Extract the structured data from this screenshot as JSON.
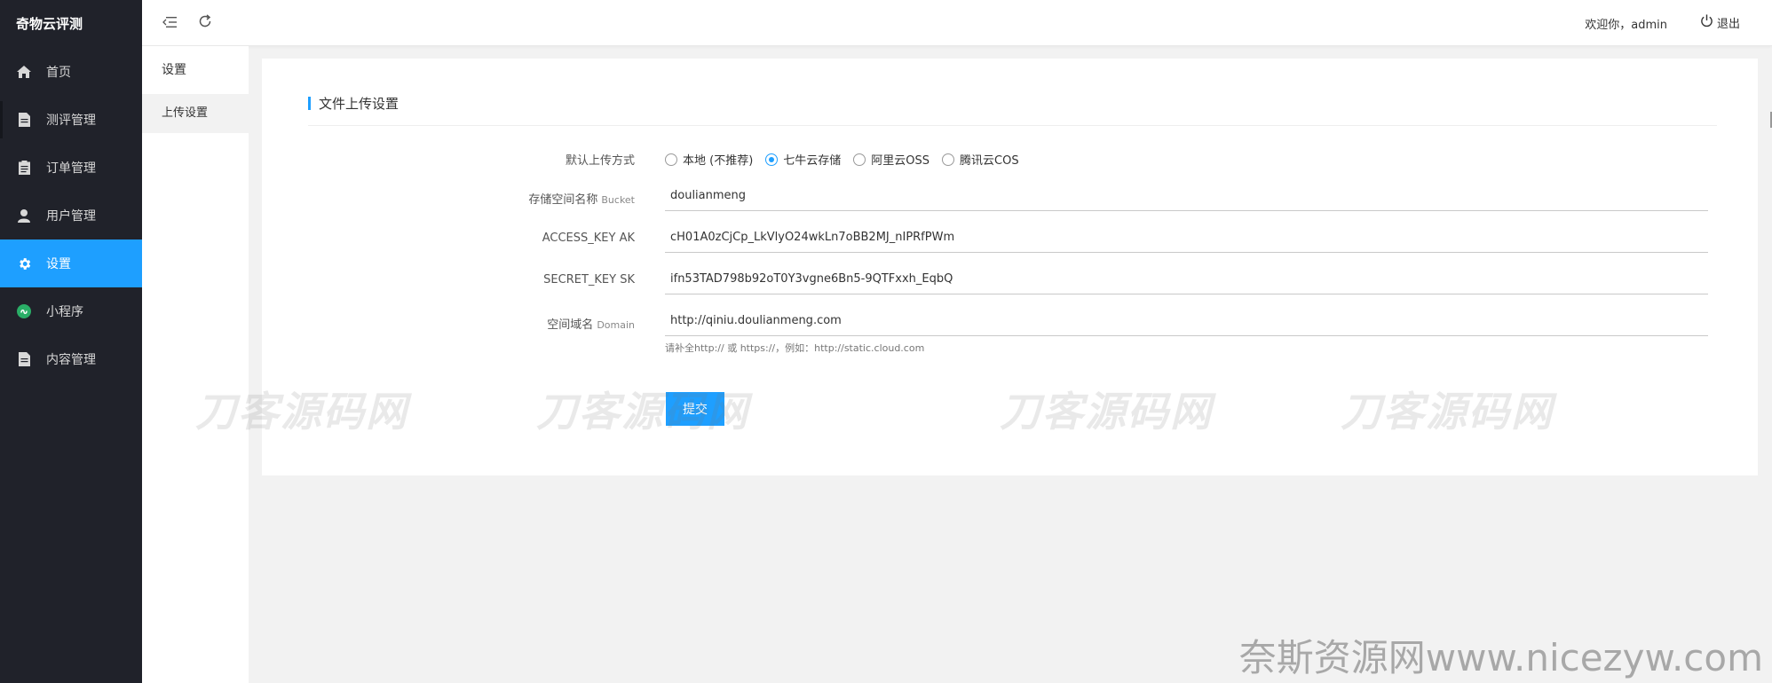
{
  "brand": "奇物云评测",
  "header": {
    "welcome": "欢迎你，admin",
    "logout": "退出"
  },
  "sidebar": {
    "items": [
      {
        "label": "首页",
        "icon": "home-icon"
      },
      {
        "label": "测评管理",
        "icon": "document-icon"
      },
      {
        "label": "订单管理",
        "icon": "clipboard-icon"
      },
      {
        "label": "用户管理",
        "icon": "user-icon"
      },
      {
        "label": "设置",
        "icon": "gear-icon",
        "active": true
      },
      {
        "label": "小程序",
        "icon": "mini-program-icon"
      },
      {
        "label": "内容管理",
        "icon": "document-icon"
      }
    ]
  },
  "submenu": {
    "title": "设置",
    "items": [
      {
        "label": "上传设置"
      }
    ]
  },
  "form": {
    "section_title": "文件上传设置",
    "upload_method_label": "默认上传方式",
    "upload_options": [
      {
        "label": "本地 (不推荐)",
        "checked": false
      },
      {
        "label": "七牛云存储",
        "checked": true
      },
      {
        "label": "阿里云OSS",
        "checked": false
      },
      {
        "label": "腾讯云COS",
        "checked": false
      }
    ],
    "bucket_label": "存储空间名称",
    "bucket_hint": "Bucket",
    "bucket_value": "doulianmeng",
    "ak_label": "ACCESS_KEY AK",
    "ak_value": "cH01A0zCjCp_LkVlyO24wkLn7oBB2MJ_nIPRfPWm",
    "sk_label": "SECRET_KEY SK",
    "sk_value": "ifn53TAD798b92oT0Y3vgne6Bn5-9QTFxxh_EqbQ",
    "domain_label": "空间域名",
    "domain_hint": "Domain",
    "domain_value": "http://qiniu.doulianmeng.com",
    "domain_help": "请补全http:// 或 https://，例如：http://static.cloud.com",
    "submit_label": "提交"
  },
  "watermarks": [
    "刀客源码网",
    "刀客源码网",
    "刀客源码网",
    "刀客源码网"
  ],
  "corner_watermark": "奈斯资源网www.nicezyw.com",
  "colors": {
    "sidebar_bg": "#20222a",
    "accent": "#1e9fff",
    "page_bg": "#f2f2f2"
  }
}
